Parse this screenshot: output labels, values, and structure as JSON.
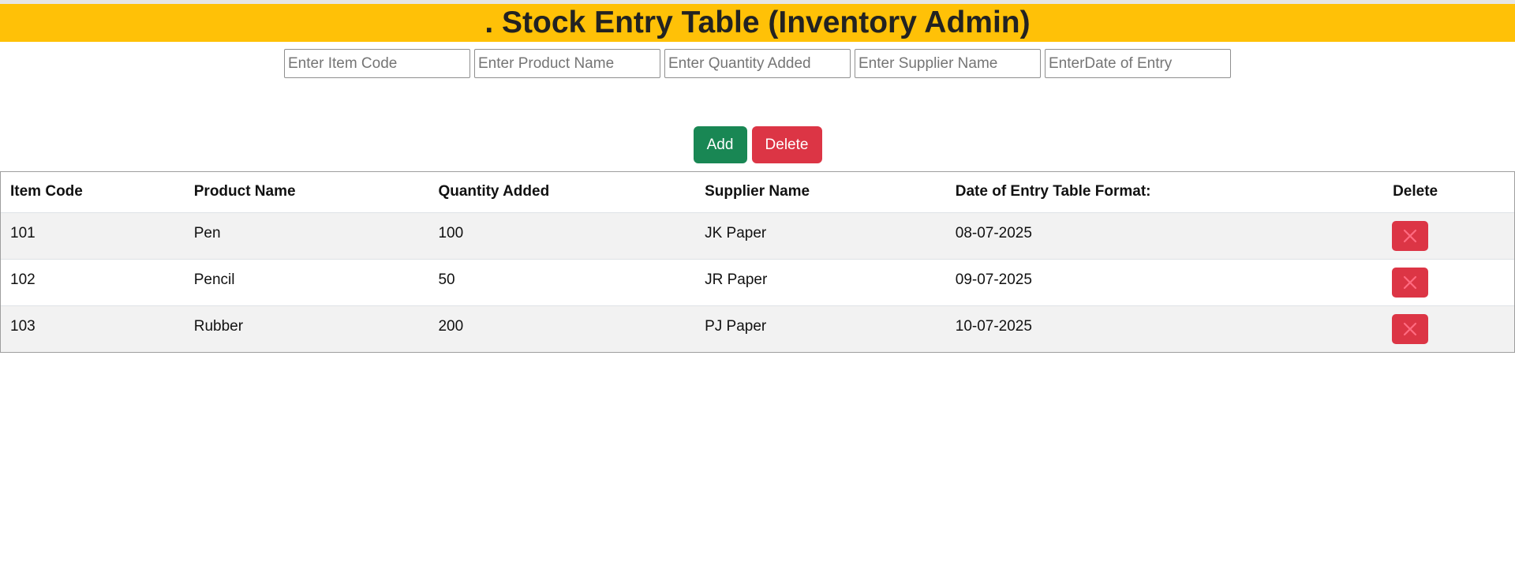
{
  "header": {
    "title": ". Stock Entry Table (Inventory Admin)"
  },
  "form": {
    "item_code_placeholder": "Enter Item Code",
    "product_name_placeholder": "Enter Product Name",
    "quantity_placeholder": "Enter Quantity Added",
    "supplier_placeholder": "Enter Supplier Name",
    "date_placeholder": "EnterDate of Entry"
  },
  "buttons": {
    "add_label": "Add",
    "delete_label": "Delete"
  },
  "table": {
    "columns": [
      "Item Code",
      "Product Name",
      "Quantity Added",
      "Supplier Name",
      "Date of Entry Table Format:",
      "Delete"
    ],
    "rows": [
      {
        "item_code": "101",
        "product_name": "Pen",
        "quantity": "100",
        "supplier": "JK Paper",
        "date": "08-07-2025",
        "delete_icon": "close-icon"
      },
      {
        "item_code": "102",
        "product_name": "Pencil",
        "quantity": "50",
        "supplier": "JR Paper",
        "date": "09-07-2025",
        "delete_icon": "close-icon"
      },
      {
        "item_code": "103",
        "product_name": "Rubber",
        "quantity": "200",
        "supplier": "PJ Paper",
        "date": "10-07-2025",
        "delete_icon": "close-icon"
      }
    ]
  },
  "colors": {
    "header_bg": "#ffc107",
    "add_button": "#198754",
    "delete_button": "#dc3545",
    "row_stripe": "#f2f2f2"
  }
}
